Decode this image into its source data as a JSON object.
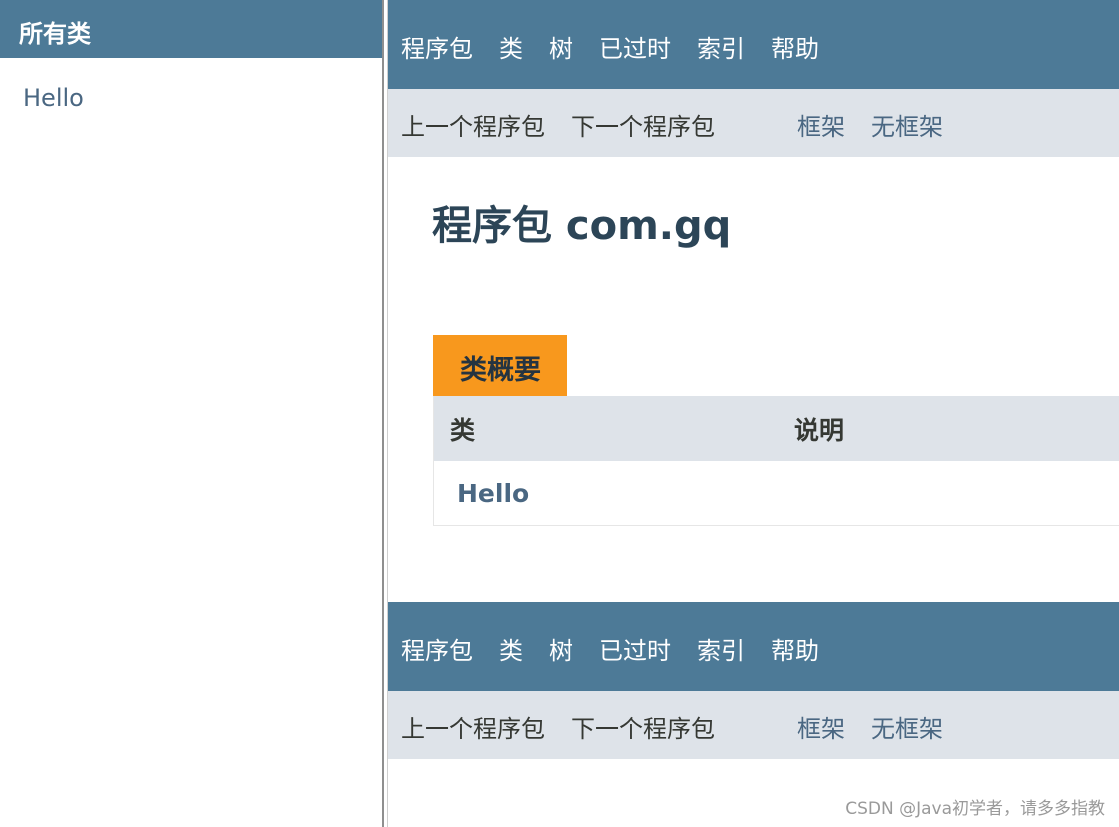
{
  "left": {
    "header": "所有类",
    "classes": [
      "Hello"
    ]
  },
  "nav": {
    "top_items": [
      "程序包",
      "类",
      "树",
      "已过时",
      "索引",
      "帮助"
    ],
    "prev_package": "上一个程序包",
    "next_package": "下一个程序包",
    "frames": "框架",
    "no_frames": "无框架"
  },
  "page": {
    "title": "程序包 com.gq"
  },
  "summary": {
    "caption": "类概要",
    "columns": [
      "类",
      "说明"
    ],
    "rows": [
      {
        "class": "Hello",
        "description": ""
      }
    ]
  },
  "watermark": "CSDN @Java初学者，请多多指教",
  "colors": {
    "nav_bg": "#4d7a97",
    "subnav_bg": "#dee3e9",
    "caption_bg": "#f8981d",
    "link": "#4a6782"
  }
}
